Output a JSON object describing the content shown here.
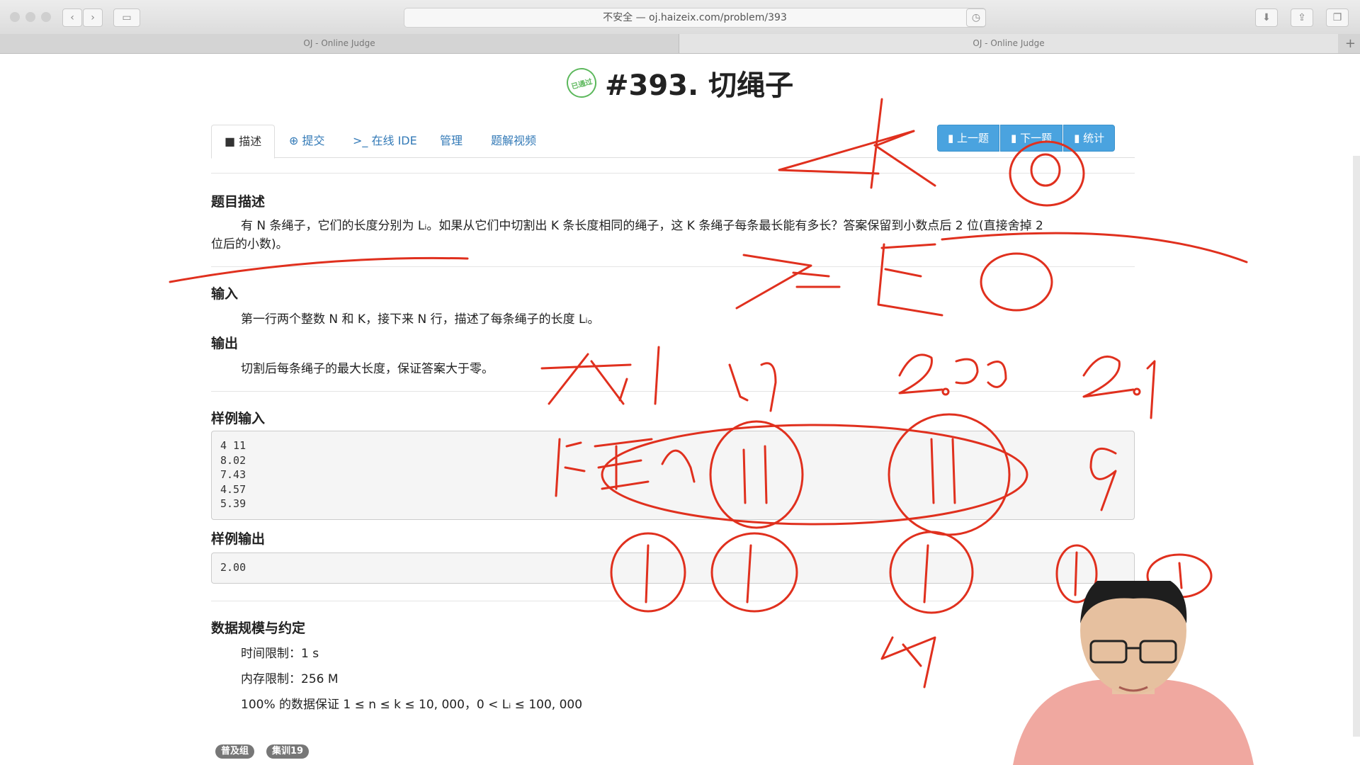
{
  "browser": {
    "url_prefix": "不安全 —",
    "url": "oj.haizeix.com/problem/393",
    "tabs": [
      "OJ - Online Judge",
      "OJ - Online Judge"
    ]
  },
  "problem": {
    "badge": "已通过",
    "title": "#393. 切绳子"
  },
  "nav_tabs": [
    "描述",
    "提交",
    "在线 IDE",
    "管理",
    "题解视频"
  ],
  "buttons": [
    "上一题",
    "下一题",
    "统计"
  ],
  "sections": {
    "desc_title": "题目描述",
    "desc_line1": "有 N 条绳子，它们的长度分别为 Lᵢ。如果从它们中切割出 K 条长度相同的绳子，这 K 条绳子每条最长能有多长？答案保留到小数点后 2 位(直接舍掉 2",
    "desc_line2": "位后的小数)。",
    "input_title": "输入",
    "input_text": "第一行两个整数 N 和 K，接下来 N 行，描述了每条绳子的长度 Lᵢ。",
    "output_title": "输出",
    "output_text": "切割后每条绳子的最大长度，保证答案大于零。",
    "sample_in_title": "样例输入",
    "sample_in": [
      "4 11",
      "8.02",
      "7.43",
      "4.57",
      "5.39"
    ],
    "sample_out_title": "样例输出",
    "sample_out": [
      "2.00"
    ],
    "limits_title": "数据规模与约定",
    "time_limit": "时间限制：1 s",
    "mem_limit": "内存限制：256 M",
    "range": "100% 的数据保证 1 ≤ n ≤ k ≤ 10, 000，0 < Lᵢ ≤ 100, 000"
  },
  "tags": [
    "普及组",
    "集训19"
  ],
  "colors": {
    "link": "#337ab7",
    "button": "#4aa3df",
    "ink": "#e0301e",
    "badge": "#5cb85c"
  }
}
